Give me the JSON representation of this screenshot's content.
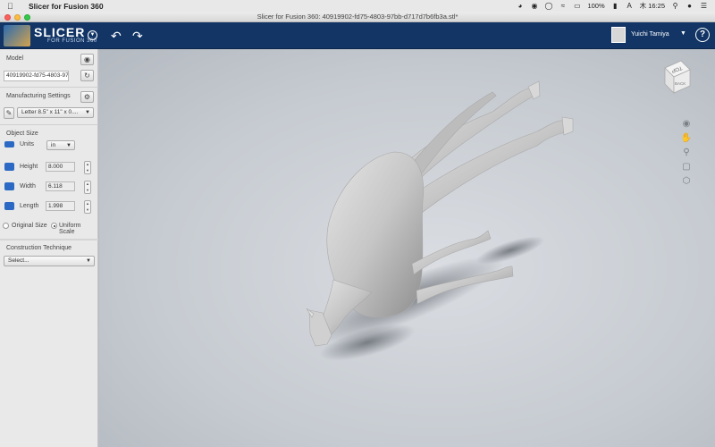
{
  "menubar": {
    "app_name": "Slicer for Fusion 360",
    "battery": "100%",
    "input_icon": "A",
    "datetime": "木 16:25"
  },
  "window": {
    "title": "Slicer for Fusion 360: 40919902-fd75-4803-97bb-d717d7b6fb3a.stl*"
  },
  "header": {
    "logo_line1": "SLICER",
    "logo_line2": "FOR FUSION 360",
    "user_name": "Yuichi Tamiya",
    "help_label": "?"
  },
  "sidebar": {
    "model_label": "Model",
    "model_value": "40919902-fd75-4803-97",
    "manufacturing_label": "Manufacturing Settings",
    "manufacturing_value": "Letter 8.5\" x 11\" x 0....",
    "object_size_label": "Object Size",
    "units_label": "Units",
    "units_value": "in",
    "height_label": "Height",
    "height_value": "8.000",
    "width_label": "Width",
    "width_value": "6.118",
    "length_label": "Length",
    "length_value": "1.998",
    "original_size_label": "Original Size",
    "uniform_scale_label": "Uniform Scale",
    "construction_label": "Construction Technique",
    "construction_value": "Select..."
  },
  "viewcube": {
    "top_label": "TOP",
    "back_label": "BACK"
  },
  "colors": {
    "header_bg": "#123566",
    "accent": "#2b69c4",
    "model_gray": "#cfcfcf"
  }
}
